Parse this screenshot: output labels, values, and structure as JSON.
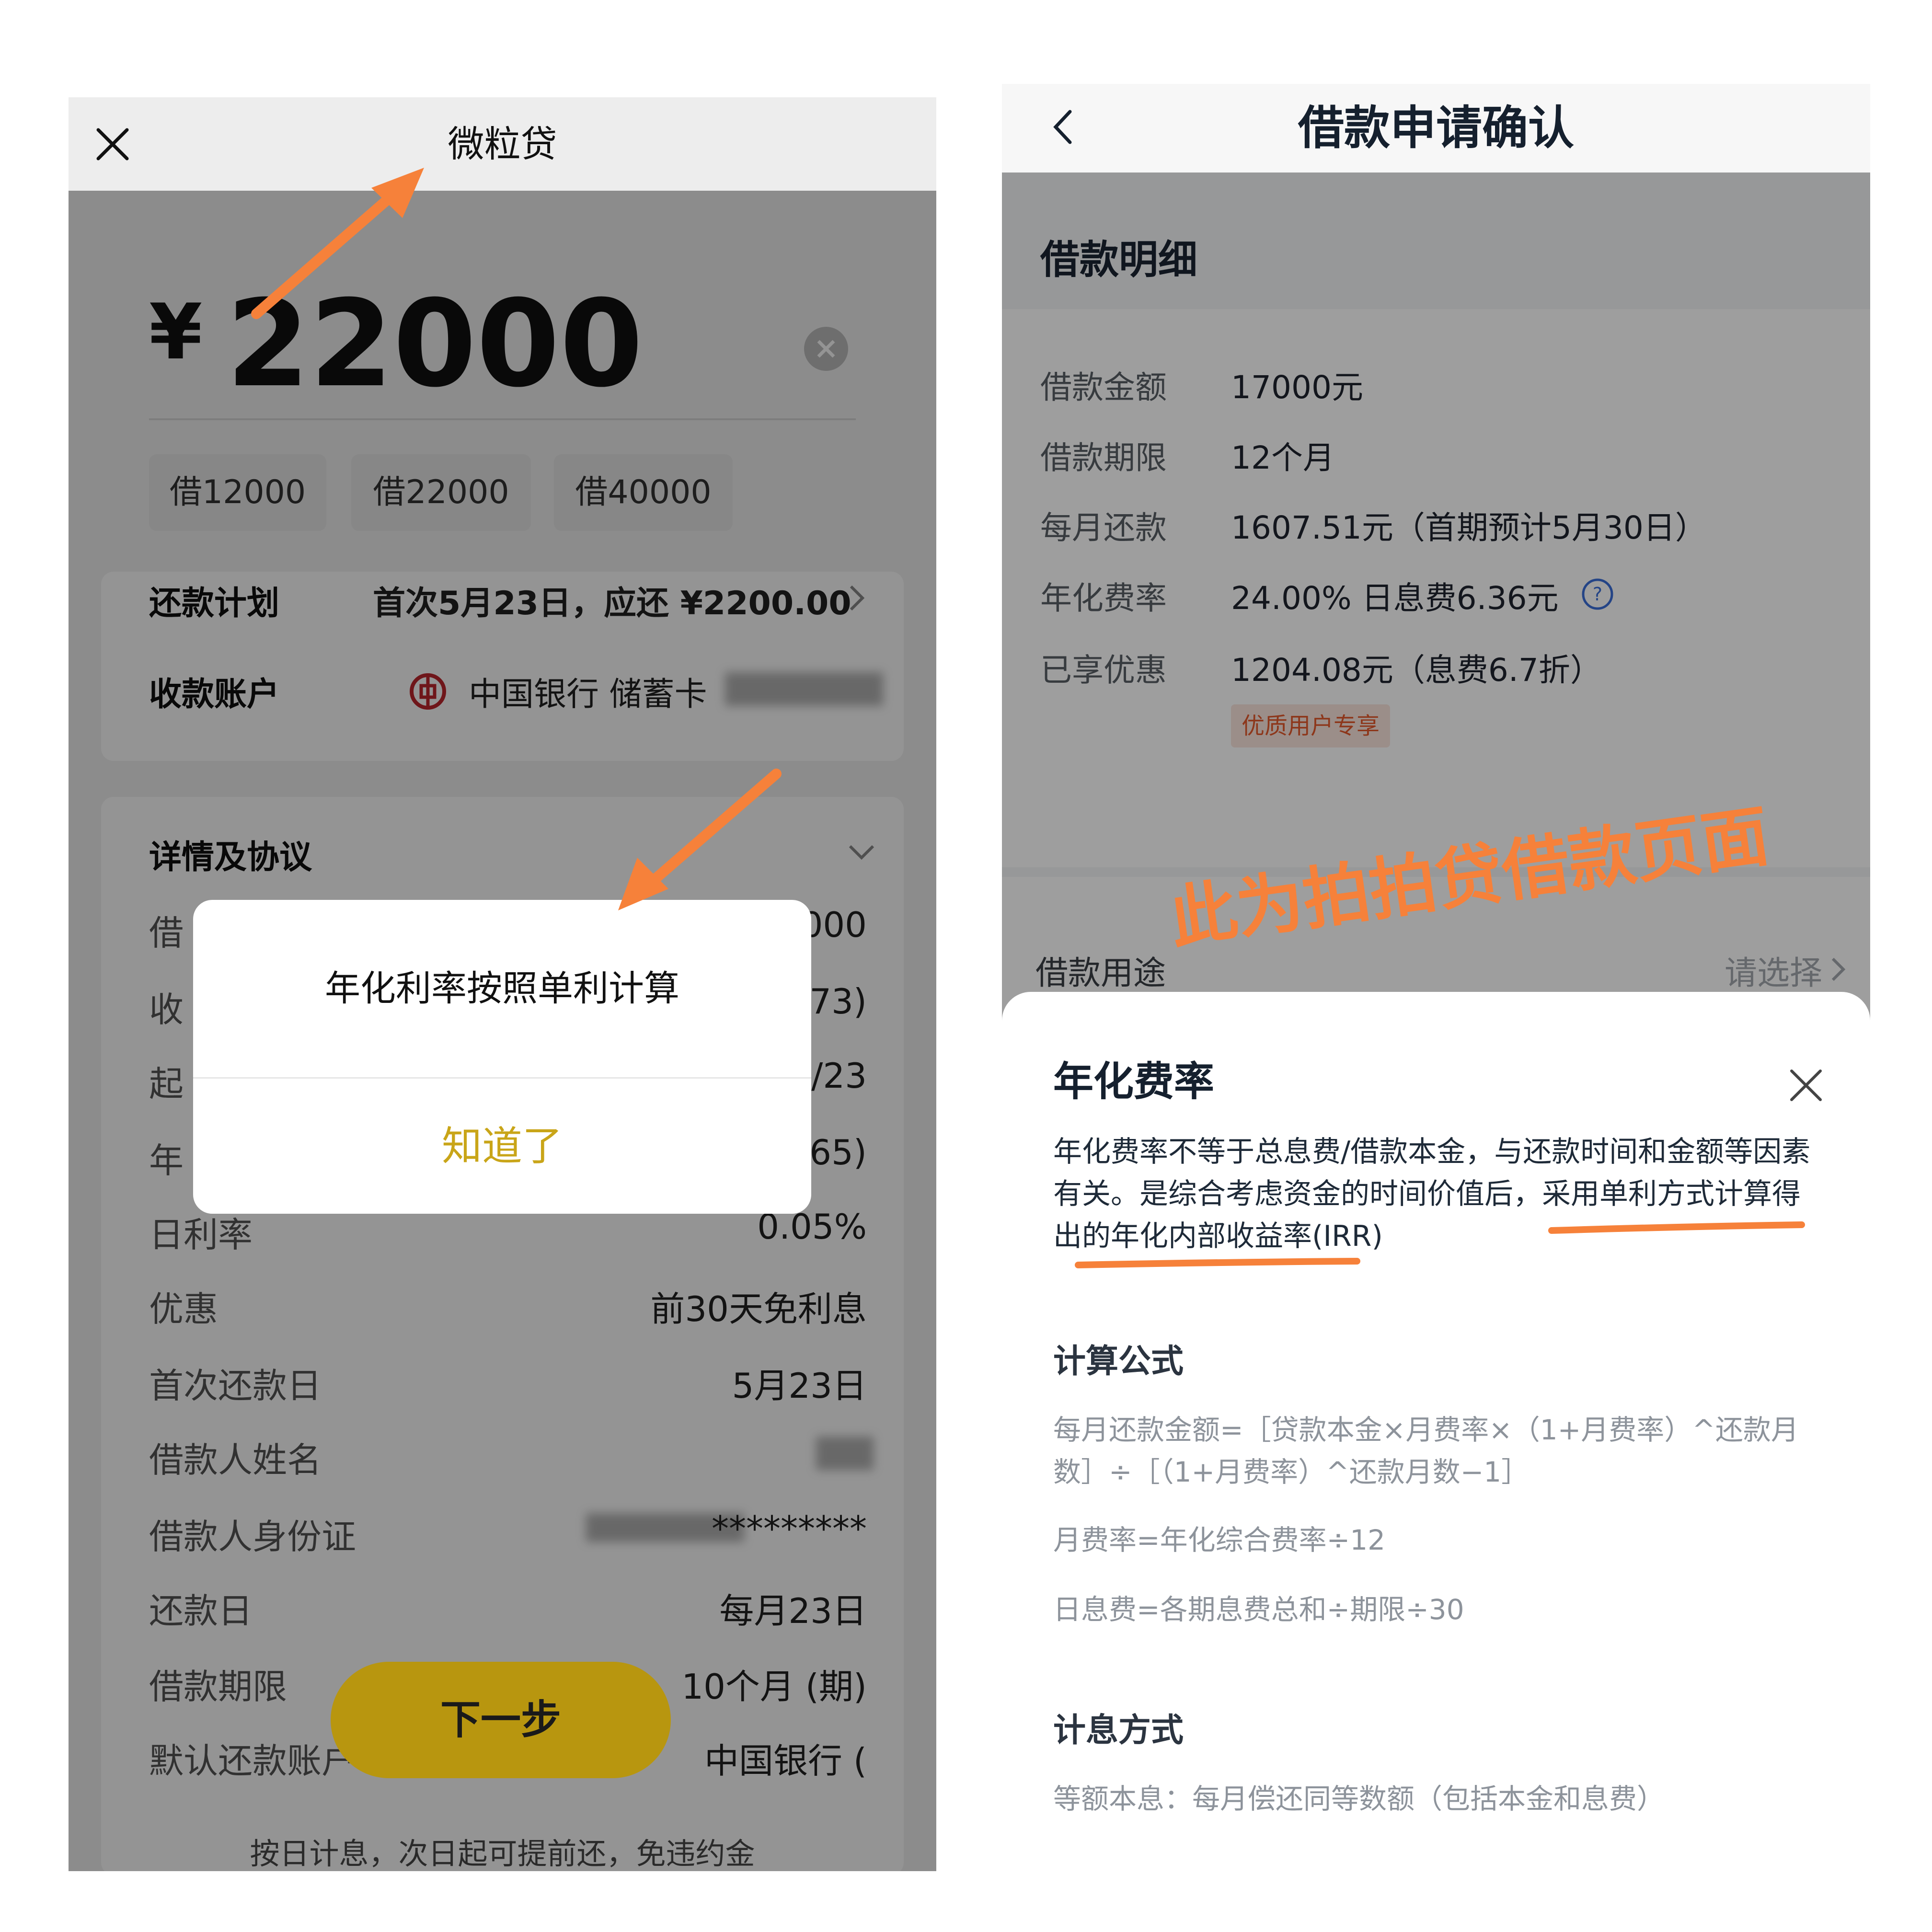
{
  "left_screen": {
    "nav": {
      "close_icon": "close-icon",
      "title": "微粒贷"
    },
    "amount": {
      "currency": "¥",
      "value": "22000",
      "clear_icon": "clear-circle-icon"
    },
    "chips": [
      "借12000",
      "借22000",
      "借40000"
    ],
    "repayment_plan": {
      "label": "还款计划",
      "value": "首次5月23日，应还 ¥2200.00",
      "arrow": "chevron-right-icon"
    },
    "receiving_account": {
      "label": "收款账户",
      "bank_icon": "bank-of-china-icon",
      "value": "中国银行 储蓄卡"
    },
    "details": {
      "title": "详情及协议",
      "arrow": "chevron-down-icon",
      "rows": [
        {
          "label": "借",
          "value": "000"
        },
        {
          "label": "收",
          "value": "73)"
        },
        {
          "label": "起",
          "value": "/23"
        },
        {
          "label": "年",
          "value": "365)"
        },
        {
          "label": "日利率",
          "value": "0.05%"
        },
        {
          "label": "优惠",
          "value": "前30天免利息"
        },
        {
          "label": "首次还款日",
          "value": "5月23日"
        },
        {
          "label": "借款人姓名",
          "value": ""
        },
        {
          "label": "借款人身份证",
          "value": "*********"
        },
        {
          "label": "还款日",
          "value": "每月23日"
        },
        {
          "label": "借款期限",
          "value": "10个月 (期)"
        },
        {
          "label": "默认还款账户",
          "value": "中国银行 ("
        }
      ]
    },
    "dialog": {
      "message": "年化利率按照单利计算",
      "button": "知道了"
    },
    "next_button": "下一步",
    "footer_note": "按日计息，次日起可提前还，免违约金"
  },
  "right_screen": {
    "nav": {
      "back_icon": "chevron-left-icon",
      "title": "借款申请确认"
    },
    "section_title": "借款明细",
    "rows": [
      {
        "label": "借款金额",
        "value": "17000元"
      },
      {
        "label": "借款期限",
        "value": "12个月"
      },
      {
        "label": "每月还款",
        "value": "1607.51元（首期预计5月30日）"
      },
      {
        "label": "年化费率",
        "value": "24.00% 日息费6.36元"
      },
      {
        "label": "已享优惠",
        "value": "1204.08元（息费6.7折）"
      }
    ],
    "help_icon": "question-circle-icon",
    "badge": "优质用户专享",
    "purpose": {
      "label": "借款用途",
      "value": "请选择",
      "arrow": "chevron-right-icon"
    },
    "sheet": {
      "close_icon": "close-icon",
      "title": "年化费率",
      "desc_1": "年化费率不等于总息费/借款本金，与还款时间和金额等因素有关。是综合考虑资金的时间价值后，",
      "desc_highlight": "采用单利方式计算得出的年化内部收益率(IRR)",
      "formula_title": "计算公式",
      "formulas": [
        "每月还款金额=［贷款本金×月费率×（1+月费率）^还款月数］÷［（1+月费率）^还款月数−1］",
        "月费率=年化综合费率÷12",
        "日息费=各期息费总和÷期限÷30"
      ],
      "interest_title": "计息方式",
      "interest_text": "等额本息：每月偿还同等数额（包括本金和息费）"
    }
  },
  "annotation": {
    "text": "此为拍拍贷借款页面",
    "color": "#f6813a"
  },
  "colors": {
    "dialog_button": "#c9a518",
    "next_button": "#b8960f",
    "badge_text": "#e45a2c",
    "annotation": "#f6813a"
  }
}
